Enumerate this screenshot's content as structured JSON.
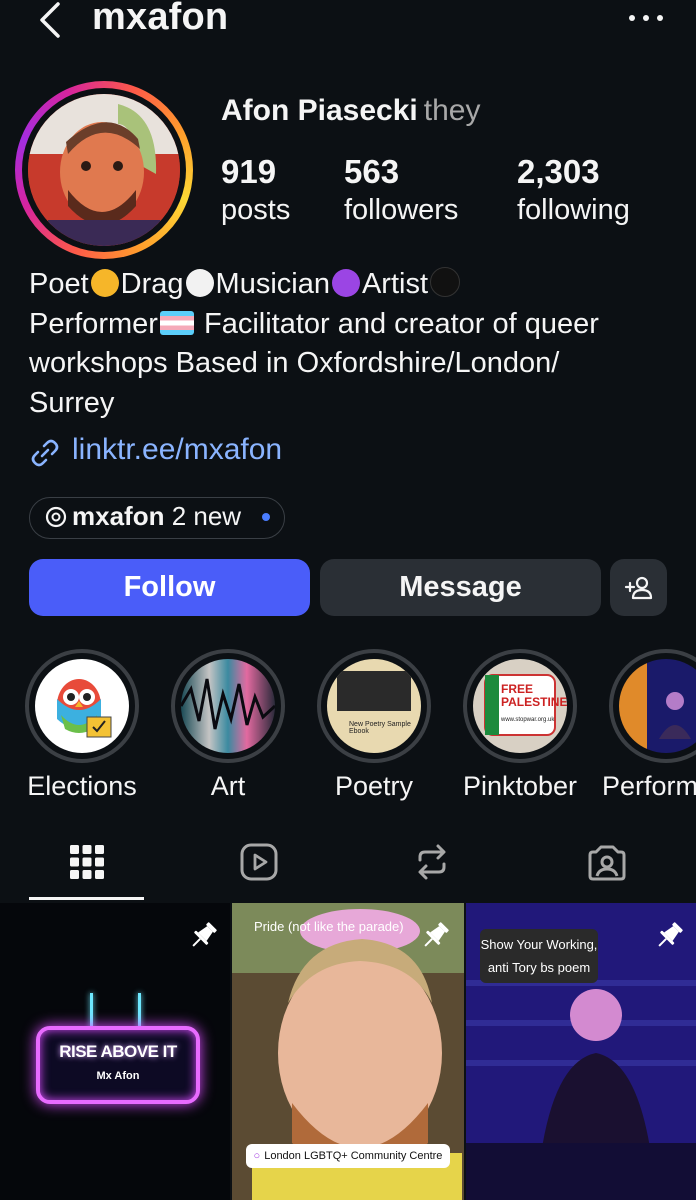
{
  "header": {
    "handle": "mxafon",
    "back_icon": "chevron-left-icon",
    "more_icon": "more-horizontal-icon"
  },
  "profile": {
    "name": "Afon Piasecki",
    "pronouns": "they",
    "stats": [
      {
        "value": "919",
        "label": "posts"
      },
      {
        "value": "563",
        "label": "followers"
      },
      {
        "value": "2,303",
        "label": "following"
      }
    ],
    "bio": {
      "line1": [
        "Poet",
        "Drag",
        "Musician",
        "Artist"
      ],
      "line1_emoji_colors": [
        "#f6b629",
        "#f2f2f2",
        "#9b45e4",
        "#111111"
      ],
      "line2_start": "Performer",
      "line2_rest": " Facilitator and creator of queer",
      "line3": "workshops Based in Oxfordshire/London/",
      "line4": "Surrey"
    },
    "link": "linktr.ee/mxafon",
    "threads": {
      "handle": "mxafon",
      "badge": "2 new"
    }
  },
  "actions": {
    "follow": "Follow",
    "message": "Message"
  },
  "highlights": [
    {
      "label": "Elections"
    },
    {
      "label": "Art"
    },
    {
      "label": "Poetry"
    },
    {
      "label": "Pinktober"
    },
    {
      "label": "Perform"
    }
  ],
  "tabs": [
    "grid-icon",
    "reels-icon",
    "reposts-icon",
    "tagged-icon"
  ],
  "posts": [
    {
      "title": "RISE ABOVE IT",
      "subtitle": "Mx Afon"
    },
    {
      "caption": "Pride (not like the parade)",
      "location": "London LGBTQ+ Community Centre"
    },
    {
      "caption": "Show Your Working, anti Tory bs poem",
      "caption_line1": "Show Your Working,",
      "caption_line2": "anti Tory bs poem"
    }
  ],
  "highlight_texts": {
    "poetry_card": "New Poetry Sample Ebook",
    "pinktober_sign": "FREE PALESTINE",
    "pinktober_url": "www.stopwar.org.uk"
  },
  "colors": {
    "background": "#0c1014",
    "accent": "#4a5df9",
    "link": "#8ab4ff"
  }
}
